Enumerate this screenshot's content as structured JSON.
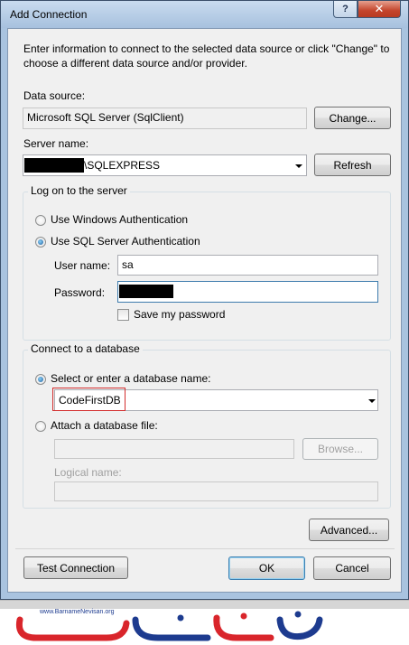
{
  "window": {
    "title": "Add Connection",
    "help_glyph": "?",
    "close_glyph": "✕"
  },
  "intro": "Enter information to connect to the selected data source or click \"Change\" to choose a different data source and/or provider.",
  "data_source": {
    "label": "Data source:",
    "value": "Microsoft SQL Server (SqlClient)",
    "change_button": "Change..."
  },
  "server": {
    "label": "Server name:",
    "value_suffix": "\\SQLEXPRESS",
    "refresh_button": "Refresh"
  },
  "logon": {
    "group_label": "Log on to the server",
    "windows_auth": "Use Windows Authentication",
    "sql_auth": "Use SQL Server Authentication",
    "selected": "sql_auth",
    "username_label": "User name:",
    "username_value": "sa",
    "password_label": "Password:",
    "save_password": "Save my password",
    "save_password_checked": false
  },
  "database": {
    "group_label": "Connect to a database",
    "select_option": "Select or enter a database name:",
    "database_name": "CodeFirstDB",
    "attach_option": "Attach a database file:",
    "browse_button": "Browse...",
    "logical_name_label": "Logical name:",
    "selected": "select_option"
  },
  "footer": {
    "advanced_button": "Advanced...",
    "test_button": "Test Connection",
    "ok_button": "OK",
    "cancel_button": "Cancel"
  },
  "watermark": {
    "url": "www.BarnameNevisan.org"
  },
  "colors": {
    "title_bar": "#a9c3df",
    "client_bg": "#f0f0f0",
    "highlight": "#d32f2f",
    "logo_red": "#d9252b",
    "logo_blue": "#1d3b8f"
  }
}
